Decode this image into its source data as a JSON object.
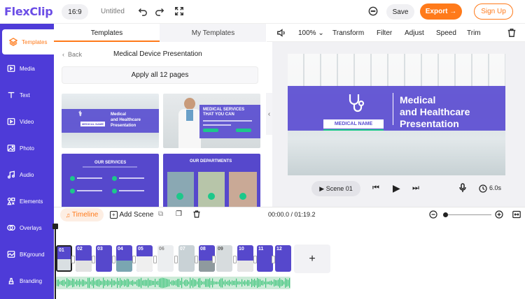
{
  "app": {
    "logo": "FlexClip",
    "aspect_ratio": "16:9",
    "doc_title": "Untitled",
    "save_label": "Save",
    "export_label": "Export →",
    "signup_label": "Sign Up"
  },
  "sidebar": {
    "items": [
      {
        "label": "Templates",
        "icon": "layers-icon",
        "active": true
      },
      {
        "label": "Media",
        "icon": "media-icon"
      },
      {
        "label": "Text",
        "icon": "text-icon"
      },
      {
        "label": "Video",
        "icon": "video-icon"
      },
      {
        "label": "Photo",
        "icon": "photo-icon"
      },
      {
        "label": "Audio",
        "icon": "audio-icon"
      },
      {
        "label": "Elements",
        "icon": "elements-icon"
      },
      {
        "label": "Overlays",
        "icon": "overlays-icon"
      },
      {
        "label": "BKground",
        "icon": "background-icon"
      },
      {
        "label": "Branding",
        "icon": "branding-icon"
      }
    ]
  },
  "panel": {
    "tabs": [
      "Templates",
      "My Templates"
    ],
    "back_label": "Back",
    "title": "Medical Device Presentation",
    "apply_label": "Apply all 12 pages",
    "thumbs": [
      {
        "lines": [
          "Medical",
          "and Healthcare",
          "Presentation"
        ],
        "tag": "MEDICAL NAME"
      },
      {
        "lines": [
          "MEDICAL SERVICES",
          "THAT YOU CAN"
        ],
        "tag": ""
      },
      {
        "lines": [
          "OUR SERVICES"
        ],
        "tag": ""
      },
      {
        "lines": [
          "OUR DEPARTMENTS"
        ],
        "tag": ""
      }
    ]
  },
  "editor_toolbar": {
    "zoom": "100%",
    "items": [
      "Transform",
      "Filter",
      "Adjust",
      "Speed",
      "Trim"
    ]
  },
  "stage": {
    "medical_name": "MEDICAL NAME",
    "title_lines": [
      "Medical",
      "and Healthcare",
      "Presentation"
    ]
  },
  "playback": {
    "scene_label": "Scene 01",
    "duration": "6.0s"
  },
  "timeline": {
    "tab_label": "Timeline",
    "add_scene_label": "Add Scene",
    "time": "00:00.0 / 01:19.2",
    "scenes": [
      "01",
      "02",
      "03",
      "04",
      "05",
      "06",
      "07",
      "08",
      "09",
      "10",
      "11",
      "12"
    ],
    "add_label": "+"
  },
  "colors": {
    "brand_purple": "#4e3bd8",
    "accent_orange": "#ff7a1a",
    "banner_purple": "#5c4fd2",
    "accent_green": "#1cc88a"
  }
}
